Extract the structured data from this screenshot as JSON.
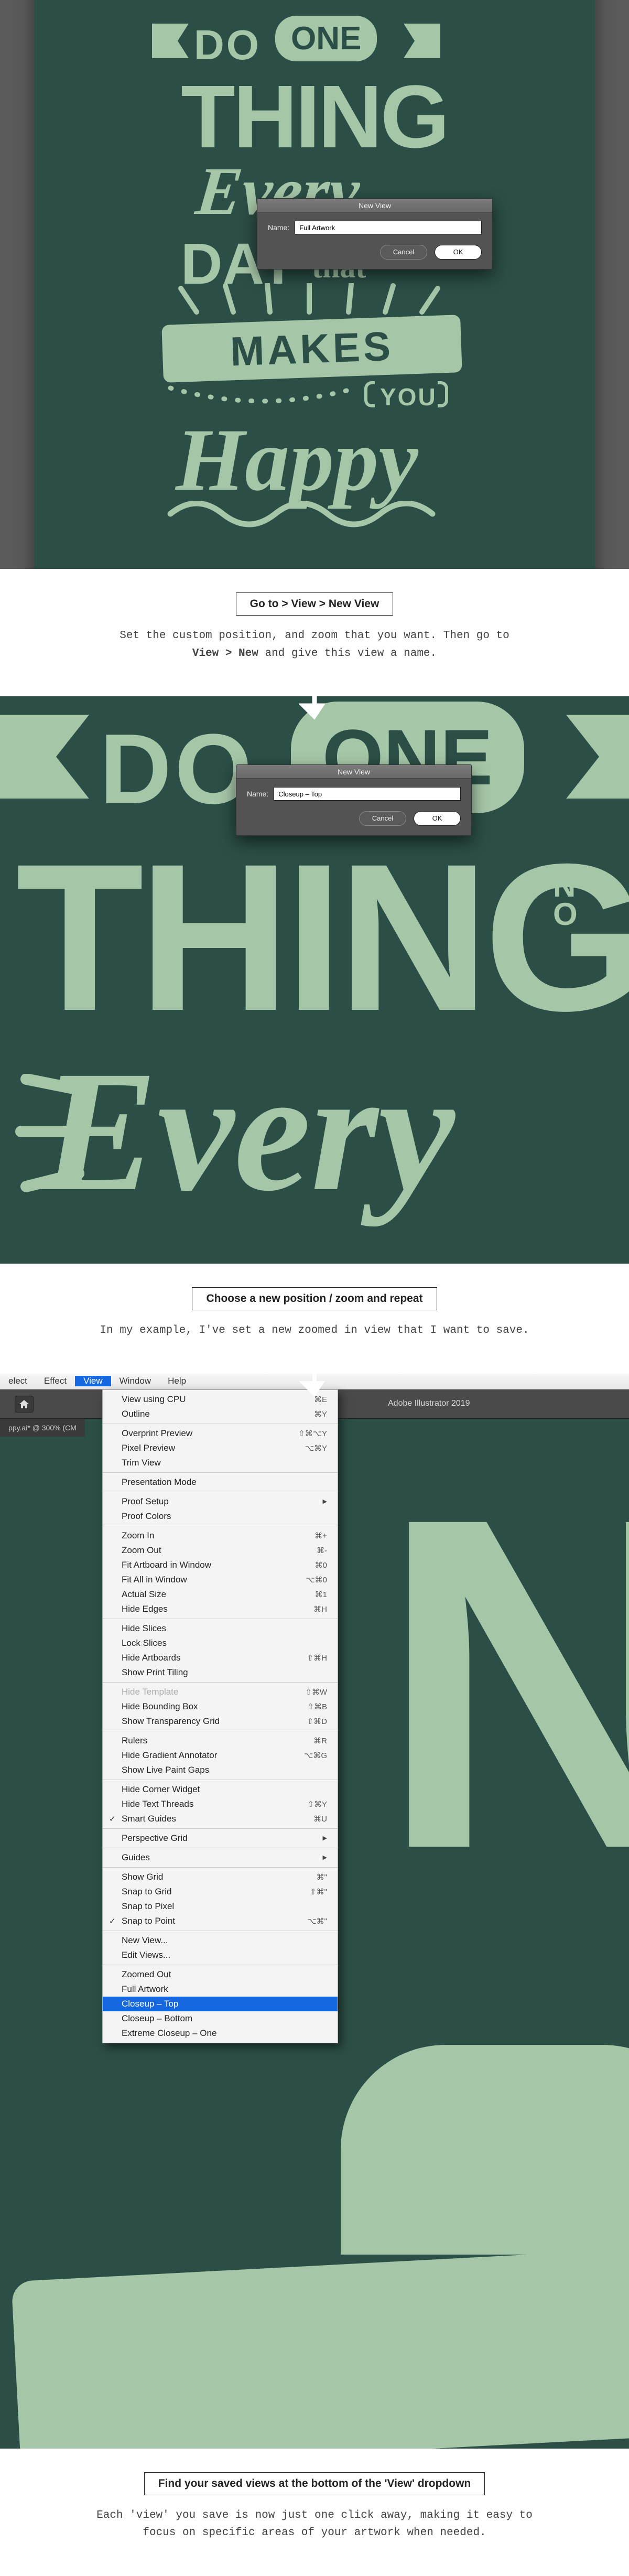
{
  "shot1": {
    "dialog_title": "New View",
    "name_label": "Name:",
    "name_value": "Full Artwork",
    "cancel": "Cancel",
    "ok": "OK",
    "artwork_words": {
      "do": "DO",
      "one": "ONE",
      "thing": "THING",
      "every": "Every",
      "day": "DAY",
      "that": "that",
      "makes": "MAKES",
      "you": "YOU",
      "happy": "Happy"
    }
  },
  "caption1": {
    "title": "Go to > View > New View",
    "line1": "Set the custom position, and zoom that you want. Then go to",
    "line2a": "View > New",
    "line2b": " and give this view a name."
  },
  "shot2": {
    "dialog_title": "New View",
    "name_label": "Name:",
    "name_value": "Closeup – Top",
    "cancel": "Cancel",
    "ok": "OK",
    "art": {
      "do": "DO",
      "one": "ONE",
      "thing": "THING",
      "every": "Every"
    }
  },
  "caption2": {
    "title": "Choose a new position / zoom and repeat",
    "line": "In my example, I've set a new zoomed in view that I want to save."
  },
  "shot3": {
    "menubar": {
      "select": "elect",
      "effect": "Effect",
      "view": "View",
      "window": "Window",
      "help": "Help"
    },
    "app_title": "Adobe Illustrator 2019",
    "doc_tab": "ppy.ai* @ 300% (CM",
    "groups": [
      [
        {
          "label": "View using CPU",
          "sc": "⌘E"
        },
        {
          "label": "Outline",
          "sc": "⌘Y"
        }
      ],
      [
        {
          "label": "Overprint Preview",
          "sc": "⇧⌘⌥Y"
        },
        {
          "label": "Pixel Preview",
          "sc": "⌥⌘Y"
        },
        {
          "label": "Trim View"
        }
      ],
      [
        {
          "label": "Presentation Mode"
        }
      ],
      [
        {
          "label": "Proof Setup",
          "submenu": true
        },
        {
          "label": "Proof Colors"
        }
      ],
      [
        {
          "label": "Zoom In",
          "sc": "⌘+"
        },
        {
          "label": "Zoom Out",
          "sc": "⌘-"
        },
        {
          "label": "Fit Artboard in Window",
          "sc": "⌘0"
        },
        {
          "label": "Fit All in Window",
          "sc": "⌥⌘0"
        },
        {
          "label": "Actual Size",
          "sc": "⌘1"
        },
        {
          "label": "Hide Edges",
          "sc": "⌘H"
        }
      ],
      [
        {
          "label": "Hide Slices"
        },
        {
          "label": "Lock Slices"
        },
        {
          "label": "Hide Artboards",
          "sc": "⇧⌘H"
        },
        {
          "label": "Show Print Tiling"
        }
      ],
      [
        {
          "label": "Hide Template",
          "sc": "⇧⌘W",
          "disabled": true
        },
        {
          "label": "Hide Bounding Box",
          "sc": "⇧⌘B"
        },
        {
          "label": "Show Transparency Grid",
          "sc": "⇧⌘D"
        }
      ],
      [
        {
          "label": "Rulers",
          "sc": "⌘R",
          "submenu": true
        },
        {
          "label": "Hide Gradient Annotator",
          "sc": "⌥⌘G"
        },
        {
          "label": "Show Live Paint Gaps"
        }
      ],
      [
        {
          "label": "Hide Corner Widget"
        },
        {
          "label": "Hide Text Threads",
          "sc": "⇧⌘Y"
        },
        {
          "label": "Smart Guides",
          "sc": "⌘U",
          "checked": true
        }
      ],
      [
        {
          "label": "Perspective Grid",
          "submenu": true
        }
      ],
      [
        {
          "label": "Guides",
          "submenu": true
        }
      ],
      [
        {
          "label": "Show Grid",
          "sc": "⌘\""
        },
        {
          "label": "Snap to Grid",
          "sc": "⇧⌘\""
        },
        {
          "label": "Snap to Pixel"
        },
        {
          "label": "Snap to Point",
          "sc": "⌥⌘\"",
          "checked": true
        }
      ],
      [
        {
          "label": "New View..."
        },
        {
          "label": "Edit Views..."
        }
      ],
      [
        {
          "label": "Zoomed Out"
        },
        {
          "label": "Full Artwork"
        },
        {
          "label": "Closeup – Top",
          "highlight": true
        },
        {
          "label": "Closeup – Bottom"
        },
        {
          "label": "Extreme Closeup – One"
        }
      ]
    ],
    "big_n": "N"
  },
  "caption3": {
    "title": "Find your saved views at the bottom of the 'View' dropdown",
    "line1": "Each 'view' you save is now just one click away, making it easy to",
    "line2": "focus on specific areas of your artwork when needed."
  }
}
